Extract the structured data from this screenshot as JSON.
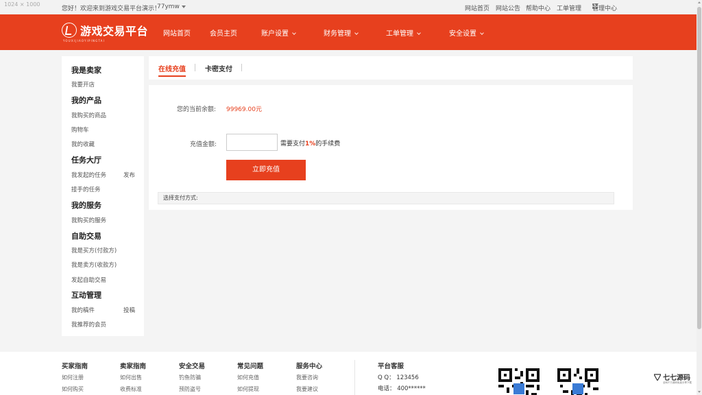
{
  "topbar": {
    "dimensions_overlay": "1024 × 1000",
    "welcome": "您好！欢迎来到游戏交易平台演示！",
    "username": "77ymw",
    "links": [
      "网站首页",
      "网站公告",
      "帮助中心",
      "工单管理",
      "管理中心"
    ]
  },
  "nav": {
    "logo_text": "游戏交易平台",
    "logo_sub": "YOUXIJIAOYIPINGTAI",
    "items": [
      "网站首页",
      "会员主页",
      "账户设置",
      "财务管理",
      "工单管理",
      "安全设置"
    ]
  },
  "sidebar": {
    "sections": [
      {
        "title": "我是卖家",
        "items": [
          "我要开店"
        ]
      },
      {
        "title": "我的产品",
        "items": [
          "我购买的商品",
          "购物车",
          "我的收藏"
        ]
      },
      {
        "title": "任务大厅",
        "items": [
          "我发起的任务",
          "接手的任务"
        ],
        "extra": "发布"
      },
      {
        "title": "我的服务",
        "items": [
          "我购买的服务"
        ]
      },
      {
        "title": "自助交易",
        "items": [
          "我是买方(付款方)",
          "我是卖方(收款方)",
          "发起自助交易"
        ]
      },
      {
        "title": "互动管理",
        "items": [
          "我的稿件",
          "我推荐的会员"
        ],
        "extra": "投稿"
      }
    ]
  },
  "tabs": [
    "在线充值",
    "卡密支付"
  ],
  "recharge": {
    "balance_label": "您的当前余额:",
    "balance_value": "99969.00元",
    "amount_label": "充值金额:",
    "amount_value": "",
    "fee_prefix": "需要支付",
    "fee_rate": "1%",
    "fee_suffix": "的手续费",
    "submit_label": "立即充值",
    "pay_method_label": "选择支付方式:"
  },
  "footer": {
    "columns": [
      {
        "title": "买家指南",
        "items": [
          "如何注册",
          "如何购买"
        ]
      },
      {
        "title": "卖家指南",
        "items": [
          "如何出售",
          "收费标准"
        ]
      },
      {
        "title": "安全交易",
        "items": [
          "钓鱼防骗",
          "预防盗号"
        ]
      },
      {
        "title": "常见问题",
        "items": [
          "如何充值",
          "如何提现"
        ]
      },
      {
        "title": "服务中心",
        "items": [
          "我要咨询",
          "我要建议"
        ]
      }
    ],
    "service": {
      "title": "平台客服",
      "qq": "Q Q：  123456",
      "phone": "电话：  400******"
    },
    "brand_text": "七七源码",
    "brand_sub": "全网千万源码免费分享下载"
  },
  "colors": {
    "accent": "#e7401e",
    "background": "#f4f4f4"
  }
}
